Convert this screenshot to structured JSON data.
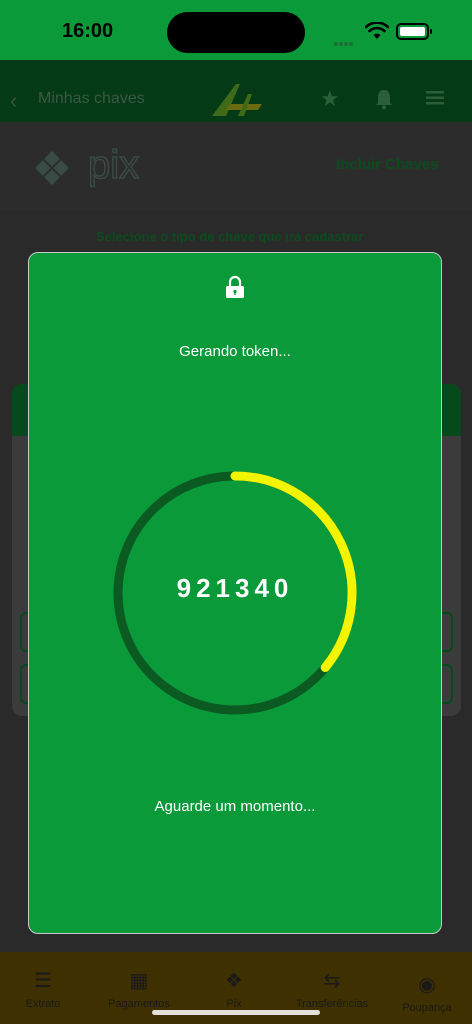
{
  "status_bar": {
    "time": "16:00"
  },
  "app_header": {
    "title": "Minhas chaves"
  },
  "pix": {
    "logo_text": "pix",
    "include_label": "Incluir Chaves",
    "select_label": "Selecione o tipo de chave que irá cadastrar"
  },
  "modal": {
    "title": "Gerando token...",
    "token": "921340",
    "wait_text": "Aguarde um momento...",
    "progress": 0.36,
    "colors": {
      "background": "#0a9a3a",
      "track": "#0b5a22",
      "progress": "#f3f500"
    }
  },
  "tabs": [
    {
      "label": "Extrato",
      "icon": "list-icon"
    },
    {
      "label": "Pagamentos",
      "icon": "barcode-icon"
    },
    {
      "label": "Pix",
      "icon": "pix-icon"
    },
    {
      "label": "Transferências",
      "icon": "transfer-icon"
    },
    {
      "label": "Poupança",
      "icon": "piggy-bank-icon"
    }
  ]
}
